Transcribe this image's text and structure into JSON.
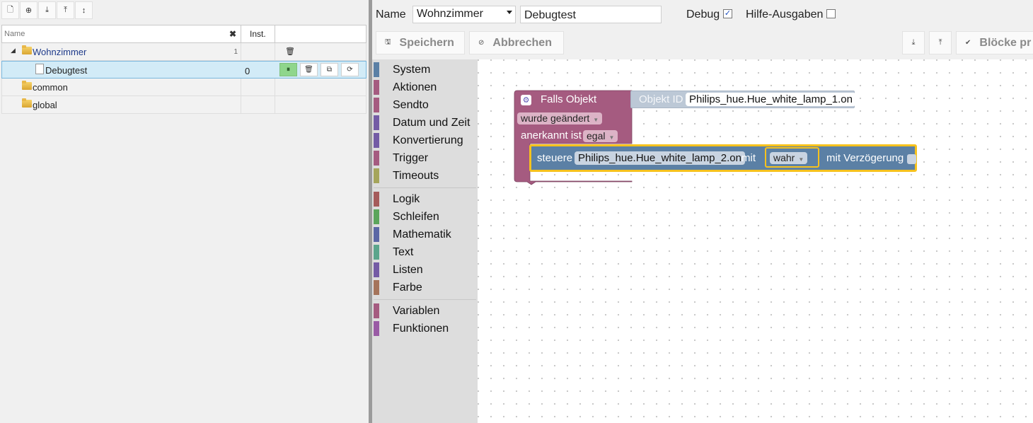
{
  "left": {
    "toolbar": [
      {
        "name": "new-script-icon",
        "glyph": "🗋"
      },
      {
        "name": "add-group-icon",
        "glyph": "⊕"
      },
      {
        "name": "export-icon",
        "glyph": "⤓"
      },
      {
        "name": "import-icon",
        "glyph": "⤒"
      },
      {
        "name": "sort-icon",
        "glyph": "↕"
      }
    ],
    "tree": {
      "header": {
        "name_placeholder": "Name",
        "clear_glyph": "✖",
        "inst": "Inst."
      },
      "rows": [
        {
          "label": "Wohnzimmer",
          "count": "1",
          "expander": "◢"
        },
        {
          "label": "Debugtest",
          "inst": "0",
          "actions": {
            "pause": "⏸",
            "delete": "🗑",
            "copy": "⧉",
            "restart": "⟳"
          }
        },
        {
          "label": "common"
        },
        {
          "label": "global"
        }
      ],
      "delete_glyph": "🗑"
    }
  },
  "right": {
    "name_label": "Name",
    "group_select": "Wohnzimmer",
    "script_name": "Debugtest",
    "debug_label": "Debug",
    "debug_checked": true,
    "help_label": "Hilfe-Ausgaben",
    "help_checked": false,
    "buttons": {
      "save": {
        "label": "Speichern",
        "icon": "🖫"
      },
      "cancel": {
        "label": "Abbrechen",
        "icon": "⊘"
      },
      "export_icon": "⤓",
      "import_icon": "⤒",
      "check": {
        "label": "Blöcke pr",
        "icon": "✔"
      }
    },
    "toolbox": [
      {
        "label": "System",
        "color": "#5b80a5"
      },
      {
        "label": "Aktionen",
        "color": "#a55b80"
      },
      {
        "label": "Sendto",
        "color": "#a55b80"
      },
      {
        "label": "Datum und Zeit",
        "color": "#735ba5"
      },
      {
        "label": "Konvertierung",
        "color": "#735ba5"
      },
      {
        "label": "Trigger",
        "color": "#a55b80"
      },
      {
        "label": "Timeouts",
        "color": "#a5a55b"
      },
      {
        "label": "Logik",
        "color": "#a55b5b"
      },
      {
        "label": "Schleifen",
        "color": "#5ba55b"
      },
      {
        "label": "Mathematik",
        "color": "#5b67a5"
      },
      {
        "label": "Text",
        "color": "#5ba58c"
      },
      {
        "label": "Listen",
        "color": "#745ba5"
      },
      {
        "label": "Farbe",
        "color": "#a5745b"
      },
      {
        "label": "Variablen",
        "color": "#a55b80"
      },
      {
        "label": "Funktionen",
        "color": "#995ba5"
      }
    ],
    "blocks": {
      "trigger": {
        "title": "Falls Objekt",
        "object_id_label": "Objekt ID",
        "object_id": "Philips_hue.Hue_white_lamp_1.on",
        "condition": "wurde geändert",
        "ack_label": "anerkannt ist",
        "ack_value": "egal",
        "color": "#a55b80"
      },
      "control": {
        "label": "steuere",
        "object_id": "Philips_hue.Hue_white_lamp_2.on",
        "with_label": "mit",
        "value": "wahr",
        "delay_label": "mit Verzögerung",
        "color": "#5b80a5",
        "highlight": "#f6c21d"
      }
    }
  }
}
